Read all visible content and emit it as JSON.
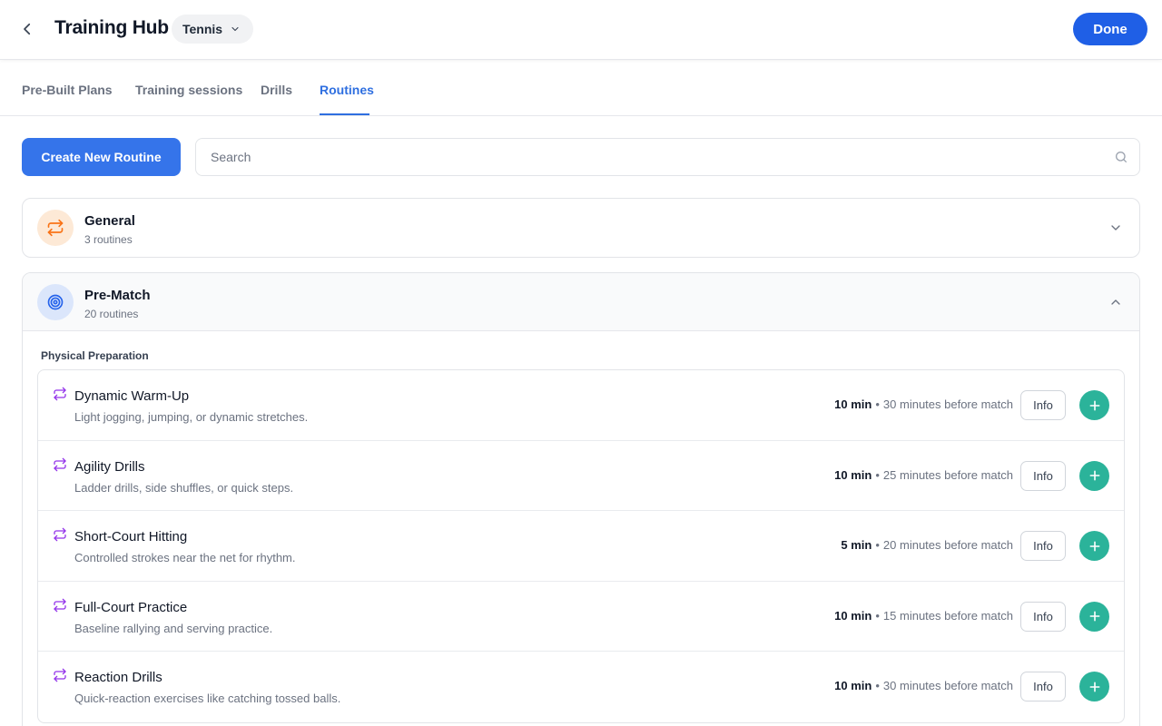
{
  "header": {
    "title": "Training Hub",
    "sport": "Tennis",
    "done_label": "Done"
  },
  "tabs": [
    {
      "label": "Pre-Built Plans",
      "active": false
    },
    {
      "label": "Training sessions",
      "active": false
    },
    {
      "label": "Drills",
      "active": false
    },
    {
      "label": "Routines",
      "active": true
    }
  ],
  "toolbar": {
    "create_label": "Create New Routine",
    "search_placeholder": "Search"
  },
  "categories": [
    {
      "title": "General",
      "count": "3 routines",
      "icon": "repeat-icon",
      "color": "#f97316",
      "bg": "#fde9d6",
      "expanded": false
    },
    {
      "title": "Pre-Match",
      "count": "20 routines",
      "icon": "target-icon",
      "color": "#2563eb",
      "bg": "#dbe6fb",
      "expanded": true
    }
  ],
  "prematch": {
    "section_label": "Physical Preparation",
    "routines": [
      {
        "title": "Dynamic Warm-Up",
        "desc": "Light jogging, jumping, or dynamic stretches.",
        "duration": "10 min",
        "timing": "30 minutes before match"
      },
      {
        "title": "Agility Drills",
        "desc": "Ladder drills, side shuffles, or quick steps.",
        "duration": "10 min",
        "timing": "25 minutes before match"
      },
      {
        "title": "Short-Court Hitting",
        "desc": "Controlled strokes near the net for rhythm.",
        "duration": "5 min",
        "timing": "20 minutes before match"
      },
      {
        "title": "Full-Court Practice",
        "desc": "Baseline rallying and serving practice.",
        "duration": "10 min",
        "timing": "15 minutes before match"
      },
      {
        "title": "Reaction Drills",
        "desc": "Quick-reaction exercises like catching tossed balls.",
        "duration": "10 min",
        "timing": "30 minutes before match"
      }
    ],
    "info_label": "Info",
    "separator": "•",
    "routine_icon": "repeat-icon",
    "routine_icon_color": "#9333ea",
    "add_color": "#2bb39a"
  },
  "colors": {
    "primary": "#1f5fe6",
    "accent_tab": "#2f6fe0"
  }
}
